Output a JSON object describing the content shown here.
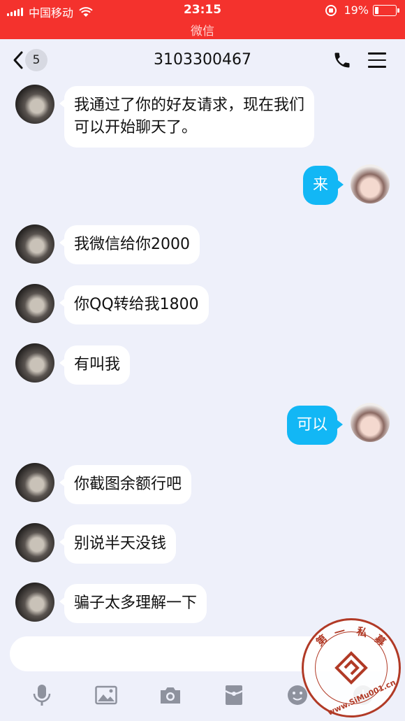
{
  "status_bar": {
    "carrier": "中国移动",
    "time": "23:15",
    "app_name": "微信",
    "battery": "19%",
    "battery_level": 0.19
  },
  "nav": {
    "unread_count": "5",
    "title": "3103300467"
  },
  "messages": [
    {
      "from": "them",
      "text_lines": [
        "我通过了你的好友请求，现在我们",
        "可以开始聊天了。"
      ]
    },
    {
      "from": "me",
      "text": "来"
    },
    {
      "from": "them",
      "text": "我微信给你2000"
    },
    {
      "from": "them",
      "text": "你QQ转给我1800"
    },
    {
      "from": "them",
      "text": "有叫我"
    },
    {
      "from": "me",
      "text": "可以"
    },
    {
      "from": "them",
      "text": "你截图余额行吧"
    },
    {
      "from": "them",
      "text": "别说半天没钱"
    },
    {
      "from": "them",
      "text": "骗子太多理解一下"
    }
  ],
  "input": {
    "placeholder": ""
  },
  "toolbar": {
    "icons": [
      "microphone-icon",
      "image-icon",
      "camera-icon",
      "red-packet-icon",
      "emoji-icon",
      "plus-icon"
    ]
  },
  "watermark": {
    "text": "第一私募 www.SiMu001.cn"
  },
  "colors": {
    "status_bar": "#f4322d",
    "my_bubble": "#12b7f5",
    "their_bubble": "#ffffff",
    "background": "#eef0fa",
    "watermark": "#b13a26"
  }
}
